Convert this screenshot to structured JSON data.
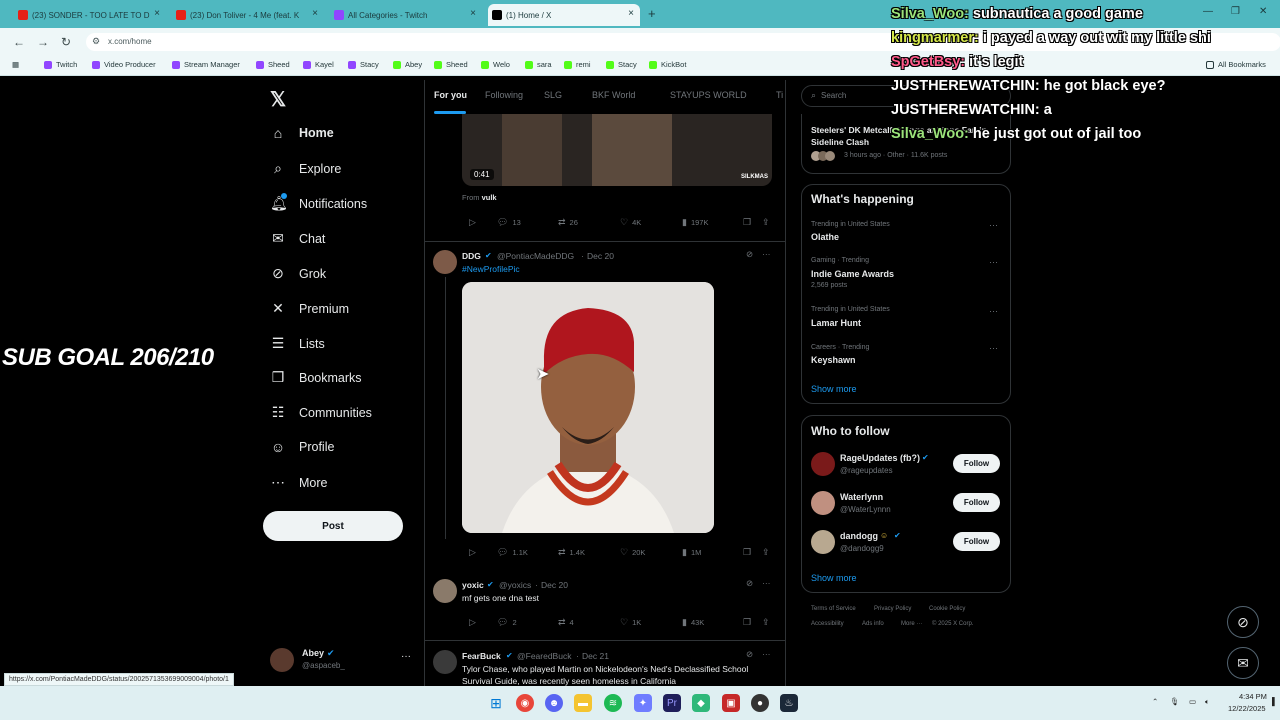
{
  "browser": {
    "tabs": [
      {
        "title": "(23) SONDER - TOO LATE TO D",
        "color": "#e62117"
      },
      {
        "title": "(23) Don Toliver - 4 Me (feat. K",
        "color": "#e62117"
      },
      {
        "title": "All Categories - Twitch",
        "color": "#9146ff"
      },
      {
        "title": "(1) Home / X",
        "color": "#000000"
      }
    ],
    "url": "x.com/home",
    "bookmarks": [
      "Twitch",
      "Video Producer",
      "Stream Manager",
      "Sheed",
      "Kayel",
      "Stacy",
      "Abey",
      "Sheed",
      "Welo",
      "sara",
      "remi",
      "Stacy",
      "KickBot"
    ],
    "all_bookmarks": "All Bookmarks",
    "status_url": "https://x.com/PontiacMadeDDG/status/2002571353699009004/photo/1"
  },
  "overlay": {
    "sub_goal": "SUB GOAL 206/210",
    "chat": [
      {
        "user": "Silva_Woo:",
        "text": "subnautica a good game",
        "color": "#9be37a"
      },
      {
        "user": "kingmarmer:",
        "text": "i payed a way out wit my little shi",
        "color": "#d6e84a"
      },
      {
        "user": "SpGetBsy:",
        "text": "it's legit",
        "color": "#ff5a8a"
      },
      {
        "user": "JUSTHEREWATCHIN:",
        "text": "he got black eye?",
        "color": "#ffffff"
      },
      {
        "user": "JUSTHEREWATCHIN:",
        "text": "a",
        "color": "#ffffff"
      },
      {
        "user": "Silva_Woo:",
        "text": "he just got out of jail too",
        "color": "#9be37a"
      }
    ]
  },
  "sidebar": {
    "items": [
      {
        "label": "Home",
        "icon": "home-icon",
        "glyph": "⌂"
      },
      {
        "label": "Explore",
        "icon": "search-icon",
        "glyph": "⌕"
      },
      {
        "label": "Notifications",
        "icon": "bell-icon",
        "glyph": "♫"
      },
      {
        "label": "Chat",
        "icon": "mail-icon",
        "glyph": "✉"
      },
      {
        "label": "Grok",
        "icon": "grok-icon",
        "glyph": "⊘"
      },
      {
        "label": "Premium",
        "icon": "x-logo-icon",
        "glyph": "✕"
      },
      {
        "label": "Lists",
        "icon": "list-icon",
        "glyph": "☰"
      },
      {
        "label": "Bookmarks",
        "icon": "bookmark-icon",
        "glyph": "❒"
      },
      {
        "label": "Communities",
        "icon": "people-icon",
        "glyph": "☷"
      },
      {
        "label": "Profile",
        "icon": "person-icon",
        "glyph": "☺"
      },
      {
        "label": "More",
        "icon": "more-circle-icon",
        "glyph": "⋯"
      }
    ],
    "post_label": "Post",
    "account": {
      "name": "Abey",
      "handle": "@aspaceb_"
    }
  },
  "feed": {
    "tabs": [
      "For you",
      "Following",
      "SLG",
      "BKF World",
      "STAYUPS WORLD",
      "Ti"
    ],
    "video_time": "0:41",
    "video_watermark": "SILKMAS",
    "from_label": "From",
    "from_user": "vulk",
    "tweets": [
      {
        "replies": "13",
        "reposts": "26",
        "likes": "4K",
        "views": "197K"
      },
      {
        "name": "DDG",
        "handle": "@PontiacMadeDDG",
        "date": "Dec 20",
        "link": "#NewProfilePic",
        "replies": "1.1K",
        "reposts": "1.4K",
        "likes": "20K",
        "views": "1M"
      },
      {
        "name": "yoxic",
        "handle": "@yoxics",
        "date": "Dec 20",
        "text": "mf gets one dna test",
        "replies": "2",
        "reposts": "4",
        "likes": "1K",
        "views": "43K"
      },
      {
        "name": "FearBuck",
        "handle": "@FearedBuck",
        "date": "Dec 21",
        "text": "Tylor Chase, who played Martin on Nickelodeon's Ned's Declassified School Survival Guide, was recently seen homeless in California"
      }
    ]
  },
  "right": {
    "search_placeholder": "Search",
    "top_news": {
      "title": "Steelers' DK Metcalf Swings at Lions Fan in Sideline Clash",
      "meta": "3 hours ago · Other · 11.6K posts"
    },
    "happening_title": "What's happening",
    "trends": [
      {
        "context": "Trending in United States",
        "name": "Olathe",
        "posts": ""
      },
      {
        "context": "Gaming · Trending",
        "name": "Indie Game Awards",
        "posts": "2,569 posts"
      },
      {
        "context": "Trending in United States",
        "name": "Lamar Hunt",
        "posts": ""
      },
      {
        "context": "Careers · Trending",
        "name": "Keyshawn",
        "posts": ""
      }
    ],
    "show_more": "Show more",
    "who_title": "Who to follow",
    "follow": [
      {
        "name": "RageUpdates (fb?)",
        "handle": "@rageupdates"
      },
      {
        "name": "Waterlynn",
        "handle": "@WaterLynnn"
      },
      {
        "name": "dandogg",
        "handle": "@dandogg9"
      }
    ],
    "follow_label": "Follow",
    "footer": [
      "Terms of Service",
      "Privacy Policy",
      "Cookie Policy",
      "Accessibility",
      "Ads info",
      "More ···",
      "© 2025 X Corp."
    ]
  },
  "taskbar": {
    "time": "4:34 PM",
    "date": "12/22/2025"
  }
}
